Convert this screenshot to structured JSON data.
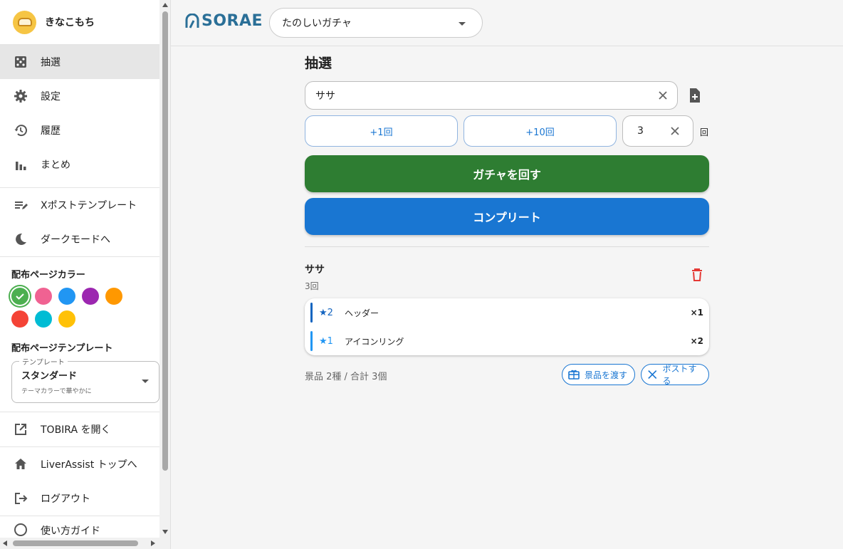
{
  "user": {
    "name": "きなこもち"
  },
  "nav": {
    "items": [
      {
        "label": "抽選",
        "icon": "dice-icon",
        "active": true
      },
      {
        "label": "設定",
        "icon": "gear-icon"
      },
      {
        "label": "履歴",
        "icon": "history-icon"
      },
      {
        "label": "まとめ",
        "icon": "bar-chart-icon"
      }
    ],
    "items2": [
      {
        "label": "Xポストテンプレート",
        "icon": "edit-list-icon"
      },
      {
        "label": "ダークモードへ",
        "icon": "moon-icon"
      }
    ],
    "items3": [
      {
        "label": "TOBIRA を開く",
        "icon": "open-external-icon"
      },
      {
        "label": "LiverAssist トップへ",
        "icon": "home-icon"
      },
      {
        "label": "ログアウト",
        "icon": "logout-icon"
      },
      {
        "label": "使い方ガイド",
        "icon": "help-icon"
      }
    ]
  },
  "color_section": {
    "title": "配布ページカラー",
    "colors": [
      "#4caf50",
      "#f06292",
      "#2196f3",
      "#9c27b0",
      "#ff9800",
      "#f44336",
      "#00bcd4",
      "#ffc107"
    ],
    "selected": "#4caf50"
  },
  "template_section": {
    "title": "配布ページテンプレート",
    "legend": "テンプレート",
    "value": "スタンダード",
    "description": "テーマカラーで華やかに"
  },
  "header": {
    "logo_text": "SORAE",
    "gacha_name": "たのしいガチャ"
  },
  "main": {
    "title": "抽選",
    "name_input_value": "ササ",
    "plus1_label": "+1回",
    "plus10_label": "+10回",
    "count_value": "3",
    "count_unit": "回",
    "spin_label": "ガチャを回す",
    "complete_label": "コンプリート",
    "colors": {
      "spin": "#2e7d32",
      "complete": "#1976d2"
    }
  },
  "result": {
    "name": "ササ",
    "count": "3回",
    "prizes": [
      {
        "rank": "★2",
        "name": "ヘッダー",
        "qty": "×1",
        "color": "#1565c0"
      },
      {
        "rank": "★1",
        "name": "アイコンリング",
        "qty": "×2",
        "color": "#2196f3"
      }
    ],
    "summary": "景品 2種 / 合計 3個",
    "give_label": "景品を渡す",
    "post_label": "ポストする"
  }
}
